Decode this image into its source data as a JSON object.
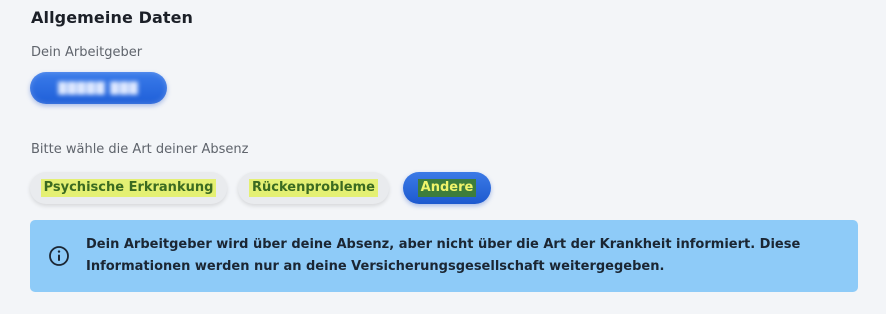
{
  "general": {
    "title": "Allgemeine Daten"
  },
  "employer": {
    "label": "Dein Arbeitgeber",
    "value_redacted": "█████ ███"
  },
  "absence": {
    "label": "Bitte wähle die Art deiner Absenz",
    "options": [
      {
        "label": "Psychische Erkrankung",
        "selected": false
      },
      {
        "label": "Rückenprobleme",
        "selected": false
      },
      {
        "label": "Andere",
        "selected": true
      }
    ]
  },
  "info": {
    "icon": "info-circle-icon",
    "text": "Dein Arbeitgeber wird über deine Absenz, aber nicht über die Art der Krankheit informiert. Diese Informationen werden nur an deine Versicherungsgesellschaft weitergegeben."
  },
  "colors": {
    "accent_blue": "#2566dc",
    "info_background": "#8ecbf8",
    "highlight_yellow": "#e4f073",
    "page_background": "#f3f5f8"
  }
}
